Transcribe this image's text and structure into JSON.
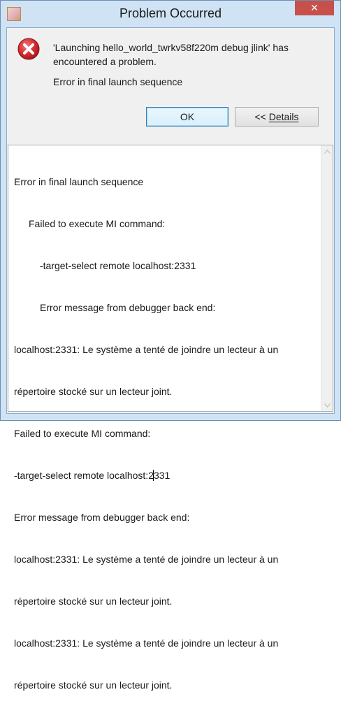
{
  "window": {
    "title": "Problem Occurred",
    "close_glyph": "✕"
  },
  "message": {
    "line1": "'Launching hello_world_twrkv58f220m debug jlink' has encountered a problem.",
    "line2": "Error in final launch sequence"
  },
  "buttons": {
    "ok_label": "OK",
    "details_prefix": "<< ",
    "details_label": "Details"
  },
  "details": {
    "lines": [
      "Error in final launch sequence",
      "Failed to execute MI command:",
      "-target-select remote localhost:2331",
      "Error message from debugger back end:",
      "localhost:2331: Le système a tenté de joindre un lecteur à un",
      "répertoire stocké sur un lecteur joint.",
      "Failed to execute MI command:",
      "-target-select remote localhost:2",
      "331",
      "Error message from debugger back end:",
      "localhost:2331: Le système a tenté de joindre un lecteur à un",
      "répertoire stocké sur un lecteur joint.",
      "localhost:2331: Le système a tenté de joindre un lecteur à un",
      "répertoire stocké sur un lecteur joint."
    ]
  },
  "icons": {
    "app": "app-icon",
    "error": "error-icon",
    "close": "close-icon",
    "scroll_up": "scroll-up-icon",
    "scroll_down": "scroll-down-icon"
  },
  "colors": {
    "title_bar": "#cfe3f4",
    "close_button": "#c7504b",
    "error_red": "#c8242b",
    "ok_border": "#3c7fb1"
  }
}
